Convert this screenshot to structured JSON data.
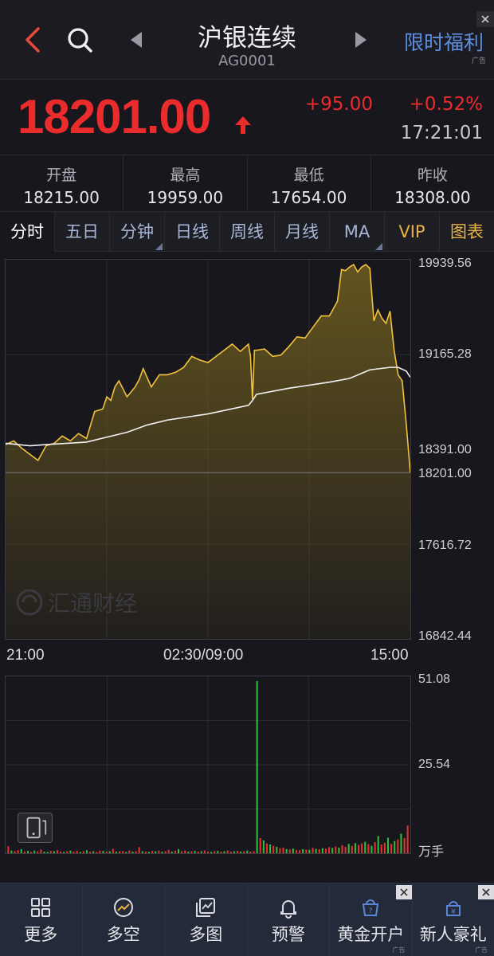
{
  "header": {
    "title": "沪银连续",
    "code": "AG0001",
    "promo": "限时福利",
    "promo_ad": "广告"
  },
  "quote": {
    "price": "18201.00",
    "change": "+95.00",
    "change_pct": "+0.52%",
    "time": "17:21:01"
  },
  "stats": [
    {
      "label": "开盘",
      "value": "18215.00"
    },
    {
      "label": "最高",
      "value": "19959.00"
    },
    {
      "label": "最低",
      "value": "17654.00"
    },
    {
      "label": "昨收",
      "value": "18308.00"
    }
  ],
  "tabs": [
    {
      "label": "分时",
      "active": true
    },
    {
      "label": "五日"
    },
    {
      "label": "分钟",
      "dropdown": true
    },
    {
      "label": "日线"
    },
    {
      "label": "周线"
    },
    {
      "label": "月线"
    },
    {
      "label": "MA",
      "dropdown": true
    },
    {
      "label": "VIP",
      "gold": true
    },
    {
      "label": "图表",
      "gold": true
    }
  ],
  "chart_data": [
    {
      "type": "line",
      "x_ticks": [
        "21:00",
        "02:30/09:00",
        "15:00"
      ],
      "y_ticks": [
        "19939.56",
        "19165.28",
        "18391.00",
        "17616.72",
        "16842.44"
      ],
      "ylim": [
        16842.44,
        19939.56
      ],
      "reference_value": 18201.0,
      "reference_label": "18201.00",
      "colors": {
        "price": "#f3c23d",
        "average": "#f2f2f2",
        "fill": "#6b5a1f"
      },
      "series": [
        {
          "role": "price",
          "x": [
            0,
            0.02,
            0.04,
            0.06,
            0.08,
            0.1,
            0.12,
            0.14,
            0.16,
            0.18,
            0.2,
            0.22,
            0.24,
            0.25,
            0.26,
            0.27,
            0.28,
            0.3,
            0.32,
            0.33,
            0.34,
            0.36,
            0.38,
            0.4,
            0.42,
            0.44,
            0.46,
            0.48,
            0.5,
            0.52,
            0.54,
            0.56,
            0.58,
            0.6,
            0.605,
            0.61,
            0.615,
            0.62,
            0.64,
            0.66,
            0.68,
            0.7,
            0.72,
            0.74,
            0.76,
            0.78,
            0.8,
            0.82,
            0.83,
            0.84,
            0.85,
            0.86,
            0.87,
            0.88,
            0.89,
            0.9,
            0.91,
            0.92,
            0.93,
            0.94,
            0.95,
            0.96,
            0.97,
            0.98,
            0.99,
            1.0
          ],
          "y": [
            18430,
            18460,
            18400,
            18350,
            18300,
            18420,
            18440,
            18500,
            18460,
            18520,
            18480,
            18700,
            18720,
            18820,
            18790,
            18900,
            18950,
            18820,
            18900,
            18960,
            19050,
            18900,
            19000,
            19000,
            19020,
            19060,
            19150,
            19120,
            19100,
            19150,
            19200,
            19250,
            19190,
            19250,
            19150,
            18800,
            19200,
            19200,
            19210,
            19150,
            19160,
            19230,
            19310,
            19300,
            19390,
            19480,
            19480,
            19600,
            19860,
            19850,
            19880,
            19900,
            19840,
            19880,
            19900,
            19870,
            19440,
            19530,
            19460,
            19420,
            19520,
            19200,
            19000,
            18950,
            18600,
            18201
          ]
        },
        {
          "role": "average",
          "x": [
            0,
            0.06,
            0.1,
            0.2,
            0.3,
            0.35,
            0.4,
            0.5,
            0.6,
            0.61,
            0.62,
            0.7,
            0.8,
            0.85,
            0.9,
            0.95,
            0.97,
            0.99,
            1.0
          ],
          "y": [
            18440,
            18420,
            18430,
            18450,
            18530,
            18590,
            18630,
            18680,
            18750,
            18790,
            18840,
            18890,
            18940,
            18970,
            19040,
            19060,
            19060,
            19030,
            18980
          ]
        }
      ]
    },
    {
      "type": "bar",
      "y_ticks": [
        "51.08",
        "25.54"
      ],
      "ylabel": "万手",
      "ylim": [
        0,
        51.08
      ],
      "values": [
        2.1,
        0.8,
        0.6,
        0.9,
        1.2,
        0.5,
        0.7,
        0.4,
        0.8,
        0.6,
        1.1,
        0.5,
        0.4,
        0.7,
        0.6,
        0.9,
        0.5,
        0.4,
        0.6,
        0.8,
        0.5,
        0.7,
        0.4,
        0.6,
        0.9,
        0.5,
        0.6,
        0.4,
        0.8,
        0.7,
        0.5,
        0.6,
        1.3,
        0.5,
        0.6,
        0.7,
        0.4,
        0.8,
        0.5,
        0.6,
        1.8,
        0.6,
        0.5,
        0.4,
        0.7,
        0.6,
        0.8,
        0.5,
        0.6,
        1.0,
        0.5,
        0.7,
        1.2,
        0.6,
        0.8,
        0.5,
        0.6,
        0.7,
        0.5,
        0.6,
        0.8,
        0.5,
        0.4,
        0.6,
        0.7,
        0.5,
        0.6,
        0.8,
        0.5,
        0.6,
        0.7,
        0.5,
        0.6,
        0.8,
        0.5,
        0.6,
        51.08,
        4.5,
        3.8,
        2.9,
        2.6,
        2.2,
        1.9,
        1.5,
        1.7,
        1.2,
        1.1,
        1.4,
        1.0,
        0.9,
        1.2,
        1.1,
        1.0,
        1.6,
        1.3,
        1.2,
        1.5,
        1.4,
        1.8,
        1.6,
        2.0,
        1.7,
        2.4,
        1.9,
        2.8,
        2.2,
        3.0,
        2.5,
        2.9,
        3.4,
        2.7,
        2.2,
        3.3,
        5.1,
        2.6,
        3.1,
        4.6,
        2.8,
        3.6,
        4.1,
        5.8,
        4.5,
        8.2
      ],
      "colors": {
        "up": "#e63232",
        "down": "#2fbf3a"
      },
      "directions": "rgrrgrgrgrrggrgrrgrgrrgrgrgrrgrgrgrrgrgrrgrgrgrgrrgrgrrgrgrgrrgrgrgrrgrgrgrrgrgrgrgrrgrgrrgrgrgrgrrgrgrrgrgrrgrgrgrrgrgrgrrgrgrg"
    }
  ],
  "watermark": "汇通财经",
  "bottom_nav": [
    {
      "label": "更多",
      "icon": "grid-icon"
    },
    {
      "label": "多空",
      "icon": "trend-icon"
    },
    {
      "label": "多图",
      "icon": "multi-chart-icon"
    },
    {
      "label": "预警",
      "icon": "bell-icon"
    },
    {
      "label": "黄金开户",
      "icon": "gold-account-icon",
      "ad": "广告",
      "closable": true
    },
    {
      "label": "新人豪礼",
      "icon": "gift-icon",
      "ad": "广告",
      "closable": true
    }
  ]
}
